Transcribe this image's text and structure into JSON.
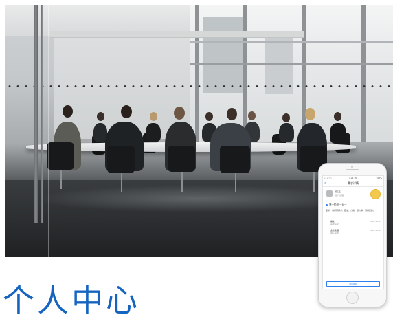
{
  "heading": "个人中心",
  "phone": {
    "status_carrier": "•••○○",
    "status_time": "4:21 PM",
    "status_battery": "100%",
    "nav_title": "需求详情",
    "profile_name": "张三",
    "profile_sub": "部门经理",
    "section_title": "第一阶段  一对一",
    "description": "要求，请按照需求，跟进，方案，报价等，保持更新。",
    "timeline": [
      {
        "label": "提交",
        "sub": "需求提交",
        "date": "2018-10-17"
      },
      {
        "label": "会议助理",
        "sub": "确认需求",
        "date": "2018-10-18"
      }
    ],
    "button_label": "进度跟踪"
  }
}
